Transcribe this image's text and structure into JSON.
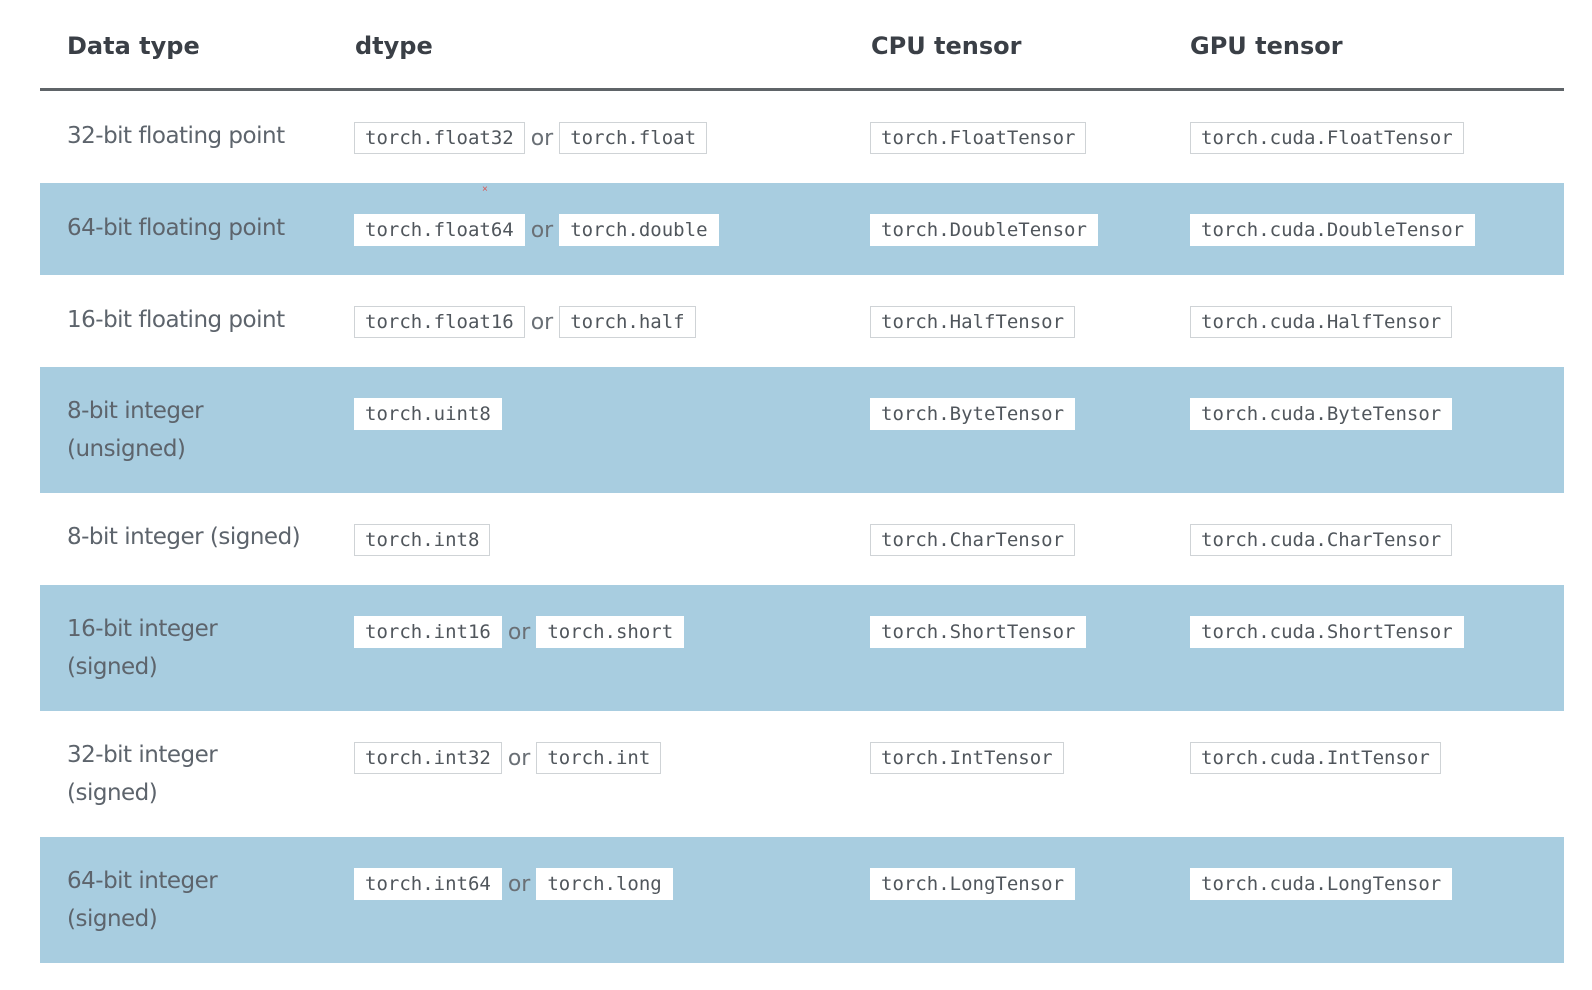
{
  "header": {
    "col_type": "Data type",
    "col_dtype": "dtype",
    "col_cpu": "CPU tensor",
    "col_gpu": "GPU tensor"
  },
  "connector": "or",
  "rows": [
    {
      "type_line1": "32-bit floating point",
      "type_line2": "",
      "dtype_a": "torch.float32",
      "dtype_b": "torch.float",
      "cpu": "torch.FloatTensor",
      "gpu": "torch.cuda.FloatTensor"
    },
    {
      "type_line1": "64-bit floating point",
      "type_line2": "",
      "dtype_a": "torch.float64",
      "dtype_b": "torch.double",
      "cpu": "torch.DoubleTensor",
      "gpu": "torch.cuda.DoubleTensor"
    },
    {
      "type_line1": "16-bit floating point",
      "type_line2": "",
      "dtype_a": "torch.float16",
      "dtype_b": "torch.half",
      "cpu": "torch.HalfTensor",
      "gpu": "torch.cuda.HalfTensor"
    },
    {
      "type_line1": "8-bit integer",
      "type_line2": "(unsigned)",
      "dtype_a": "torch.uint8",
      "dtype_b": "",
      "cpu": "torch.ByteTensor",
      "gpu": "torch.cuda.ByteTensor"
    },
    {
      "type_line1": "8-bit integer (signed)",
      "type_line2": "",
      "dtype_a": "torch.int8",
      "dtype_b": "",
      "cpu": "torch.CharTensor",
      "gpu": "torch.cuda.CharTensor"
    },
    {
      "type_line1": "16-bit integer",
      "type_line2": "(signed)",
      "dtype_a": "torch.int16",
      "dtype_b": "torch.short",
      "cpu": "torch.ShortTensor",
      "gpu": "torch.cuda.ShortTensor"
    },
    {
      "type_line1": "32-bit integer",
      "type_line2": "(signed)",
      "dtype_a": "torch.int32",
      "dtype_b": "torch.int",
      "cpu": "torch.IntTensor",
      "gpu": "torch.cuda.IntTensor"
    },
    {
      "type_line1": "64-bit integer",
      "type_line2": "(signed)",
      "dtype_a": "torch.int64",
      "dtype_b": "torch.long",
      "cpu": "torch.LongTensor",
      "gpu": "torch.cuda.LongTensor"
    }
  ],
  "colors": {
    "alt_row": "#a8cde0",
    "text": "#5d646c",
    "header_text": "#3a3f46"
  }
}
